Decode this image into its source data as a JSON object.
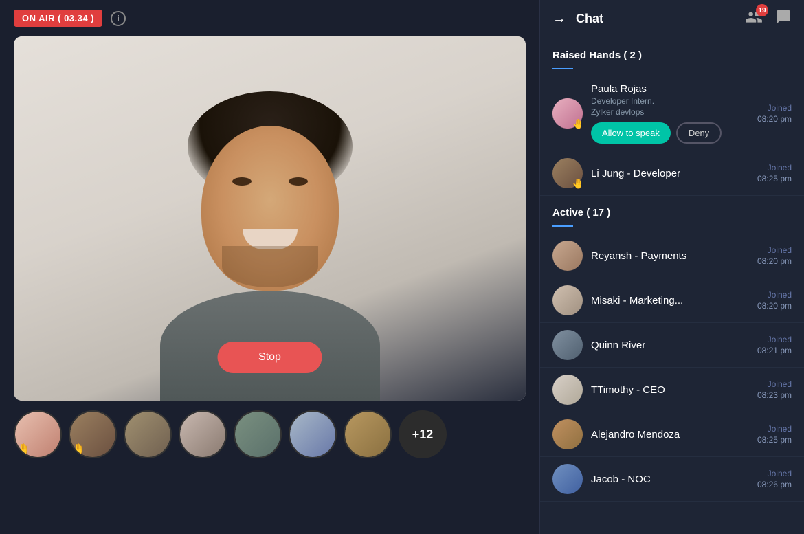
{
  "topBar": {
    "onAirLabel": "ON AIR ( 03.34 )",
    "infoIcon": "i"
  },
  "video": {
    "stopButtonLabel": "Stop"
  },
  "thumbnails": {
    "moreBadgeLabel": "+12"
  },
  "rightPanel": {
    "title": "Chat",
    "participantsBadge": "19",
    "raisedHandsSection": "Raised Hands ( 2 )",
    "activeSection": "Active  ( 17 )",
    "participants": [
      {
        "name": "Paula Rojas",
        "role": "Developer Intern.",
        "role2": "Zylker devlops",
        "joinedLabel": "Joined",
        "time": "08:20 pm",
        "hasActions": true,
        "allowLabel": "Allow to speak",
        "denyLabel": "Deny",
        "avatarClass": "av-pink",
        "hasHand": true
      },
      {
        "name": "Li Jung - Developer",
        "role": "",
        "role2": "",
        "joinedLabel": "Joined",
        "time": "08:25 pm",
        "hasActions": false,
        "avatarClass": "av-brown",
        "hasHand": true
      },
      {
        "name": "Reyansh - Payments",
        "role": "",
        "role2": "",
        "joinedLabel": "Joined",
        "time": "08:20 pm",
        "hasActions": false,
        "avatarClass": "av-tan",
        "hasHand": false
      },
      {
        "name": "Misaki - Marketing...",
        "role": "",
        "role2": "",
        "joinedLabel": "Joined",
        "time": "08:20 pm",
        "hasActions": false,
        "avatarClass": "av-light",
        "hasHand": false
      },
      {
        "name": "Quinn River",
        "role": "",
        "role2": "",
        "joinedLabel": "Joined",
        "time": "08:21 pm",
        "hasActions": false,
        "avatarClass": "av-gray",
        "hasHand": false
      },
      {
        "name": "TTimothy - CEO",
        "role": "",
        "role2": "",
        "joinedLabel": "Joined",
        "time": "08:23 pm",
        "hasActions": false,
        "avatarClass": "av-light",
        "hasHand": false
      },
      {
        "name": "Alejandro Mendoza",
        "role": "",
        "role2": "",
        "joinedLabel": "Joined",
        "time": "08:25 pm",
        "hasActions": false,
        "avatarClass": "av-warm",
        "hasHand": false
      },
      {
        "name": "Jacob - NOC",
        "role": "",
        "role2": "",
        "joinedLabel": "Joined",
        "time": "08:26 pm",
        "hasActions": false,
        "avatarClass": "av-blue",
        "hasHand": false
      }
    ]
  }
}
